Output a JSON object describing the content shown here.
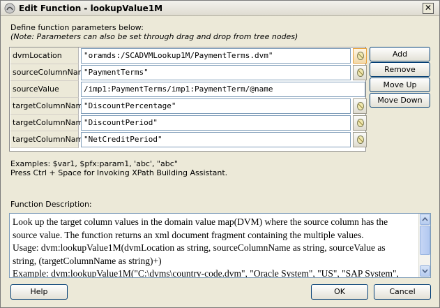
{
  "window": {
    "title": "Edit Function - lookupValue1M",
    "close_glyph": "✕"
  },
  "intro": {
    "line1": "Define function parameters below:",
    "line2": "(Note: Parameters can also be set through drag and drop from tree nodes)"
  },
  "parameters": [
    {
      "name": "dvmLocation",
      "value": "\"oramds:/SCADVMLookup1M/PaymentTerms.dvm\"",
      "has_xpath_button": true,
      "button_active": true
    },
    {
      "name": "sourceColumnName",
      "value": "\"PaymentTerms\"",
      "has_xpath_button": true,
      "button_active": false
    },
    {
      "name": "sourceValue",
      "value": "/imp1:PaymentTerms/imp1:PaymentTerm/@name",
      "has_xpath_button": false,
      "button_active": false
    },
    {
      "name": "targetColumnName",
      "value": "\"DiscountPercentage\"",
      "has_xpath_button": true,
      "button_active": false
    },
    {
      "name": "targetColumnName",
      "value": "\"DiscountPeriod\"",
      "has_xpath_button": true,
      "button_active": false
    },
    {
      "name": "targetColumnName",
      "value": "\"NetCreditPeriod\"",
      "has_xpath_button": true,
      "button_active": false
    }
  ],
  "side_buttons": {
    "add": "Add",
    "remove": "Remove",
    "move_up": "Move Up",
    "move_down": "Move Down"
  },
  "hints": {
    "examples": "Examples: $var1, $pfx:param1, 'abc', \"abc\"",
    "xpath_assist": "Press Ctrl + Space for Invoking XPath Building Assistant."
  },
  "description": {
    "label": "Function Description:",
    "lines": [
      "Look up the target column values in the domain value map(DVM) where the source column has the",
      "source value. The function returns an xml document fragment containing the multiple values.",
      "Usage: dvm:lookupValue1M(dvmLocation as string, sourceColumnName as string, sourceValue as",
      "string, (targetColumnName as string)+)",
      "Example: dvm:lookupValue1M(\"C:\\dvms\\country-code.dvm\", \"Oracle System\", \"US\", \"SAP System\","
    ]
  },
  "footer": {
    "help": "Help",
    "ok": "OK",
    "cancel": "Cancel"
  },
  "colors": {
    "dialog_bg": "#ece9d8",
    "button_border": "#003c74",
    "field_border": "#7f9db9",
    "active_button": "#e6a13a"
  },
  "icons": {
    "window": "oracle-jdeveloper-icon",
    "xpath": "xpath-builder-icon",
    "scroll_up": "scroll-up-icon",
    "scroll_down": "scroll-down-icon"
  }
}
